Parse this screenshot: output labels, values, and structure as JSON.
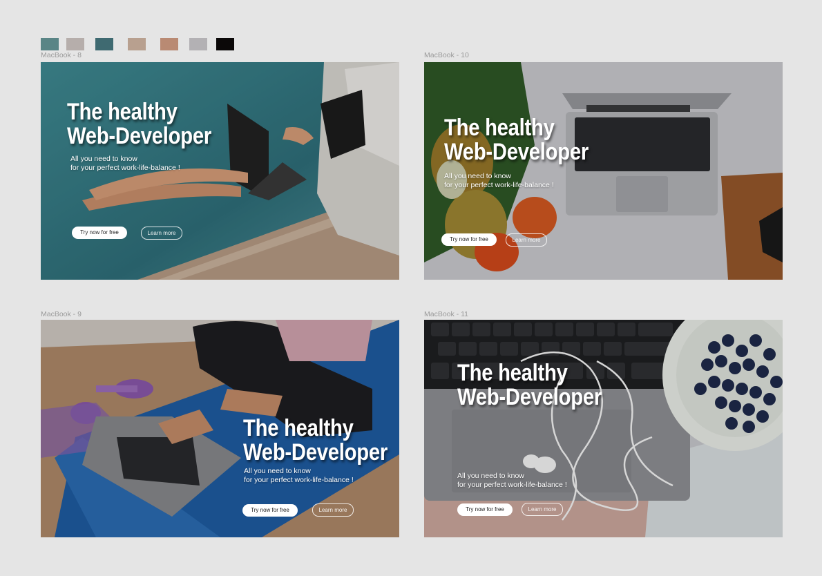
{
  "palette": [
    {
      "name": "swatch-1",
      "color": "#5a8586"
    },
    {
      "name": "swatch-2",
      "color": "#b6aeab"
    },
    {
      "name": "swatch-3",
      "color": "#3f6a71"
    },
    {
      "name": "swatch-4",
      "color": "#b8a08f"
    },
    {
      "name": "swatch-5",
      "color": "#b98a73"
    },
    {
      "name": "swatch-6",
      "color": "#b3b1b4"
    },
    {
      "name": "swatch-7",
      "color": "#0b0808"
    }
  ],
  "frames": [
    {
      "label": "MacBook - 8",
      "headline_1": "The healthy",
      "headline_2": "Web-Developer",
      "sub_1": "All you need to know",
      "sub_2": "for your perfect  work-life-balance !",
      "cta_primary": "Try now for free",
      "cta_secondary": "Learn more"
    },
    {
      "label": "MacBook - 10",
      "headline_1": "The healthy",
      "headline_2": "Web-Developer",
      "sub_1": "All you need to know",
      "sub_2": "for your perfect  work-life-balance !",
      "cta_primary": "Try now for free",
      "cta_secondary": "Learn more"
    },
    {
      "label": "MacBook - 9",
      "headline_1": "The healthy",
      "headline_2": "Web-Developer",
      "sub_1": "All you need to know",
      "sub_2": "for your perfect  work-life-balance !",
      "cta_primary": "Try now for free",
      "cta_secondary": "Learn more"
    },
    {
      "label": "MacBook - 11",
      "headline_1": "The healthy",
      "headline_2": "Web-Developer",
      "sub_1": "All you need to know",
      "sub_2": "for your perfect  work-life-balance !",
      "cta_primary": "Try now for free",
      "cta_secondary": "Learn more"
    }
  ]
}
